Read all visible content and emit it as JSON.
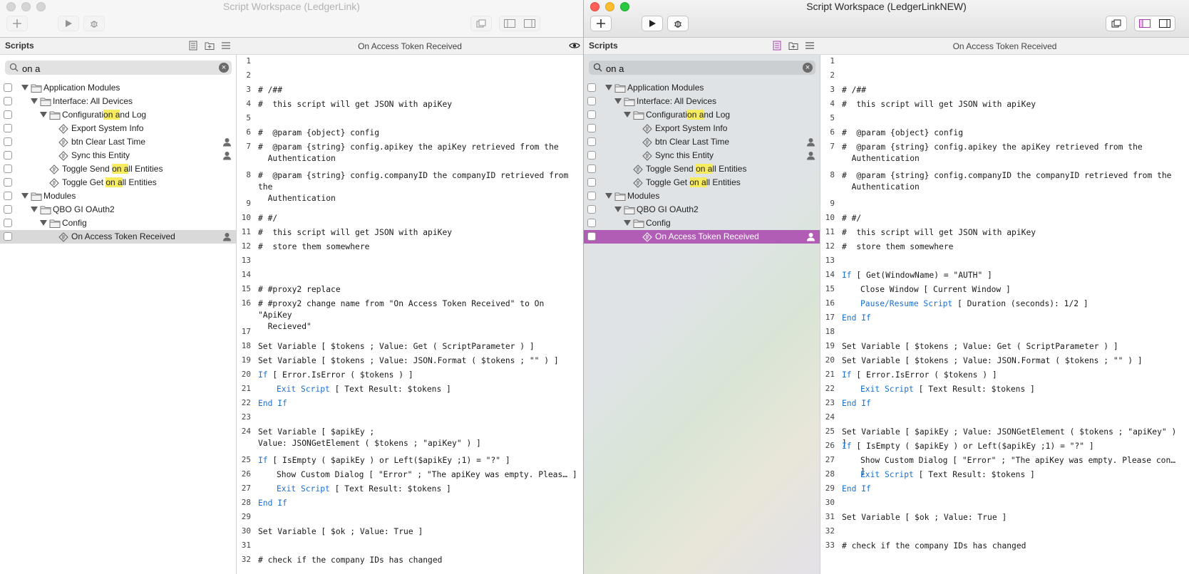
{
  "left_window": {
    "title": "Script Workspace (LedgerLink)",
    "scripts_label": "Scripts",
    "search_value": "on a",
    "editor_title": "On Access Token Received",
    "tree": [
      {
        "label": "Application Modules",
        "level": 0,
        "type": "folder",
        "expanded": true
      },
      {
        "label": "Interface: All Devices",
        "level": 1,
        "type": "folder",
        "expanded": true
      },
      {
        "label_pre": "Configurati",
        "label_hl": "on a",
        "label_post": "nd Log",
        "level": 2,
        "type": "folder",
        "expanded": true
      },
      {
        "label": "Export System Info",
        "level": 3,
        "type": "script"
      },
      {
        "label": "btn Clear Last Time",
        "level": 3,
        "type": "script",
        "user": true
      },
      {
        "label": "Sync this Entity",
        "level": 3,
        "type": "script",
        "user": true
      },
      {
        "label_pre": "Toggle Send ",
        "label_hl": "on a",
        "label_post": "ll Entities",
        "level": 2,
        "type": "script"
      },
      {
        "label_pre": "Toggle Get ",
        "label_hl": "on a",
        "label_post": "ll Entities",
        "level": 2,
        "type": "script"
      },
      {
        "label": "Modules",
        "level": 0,
        "type": "folder",
        "expanded": true
      },
      {
        "label": "QBO GI OAuth2",
        "level": 1,
        "type": "folder",
        "expanded": true
      },
      {
        "label": "Config",
        "level": 2,
        "type": "folder",
        "expanded": true
      },
      {
        "label": "On Access Token Received",
        "level": 3,
        "type": "script",
        "user": true,
        "selected": true
      }
    ],
    "code": [
      {
        "n": "1",
        "t": "",
        "c": "plain"
      },
      {
        "n": "2",
        "t": "",
        "c": "plain"
      },
      {
        "n": "3",
        "t": "# /##",
        "c": "cmt"
      },
      {
        "n": "4",
        "t": "#  this script will get JSON with apiKey",
        "c": "cmt"
      },
      {
        "n": "5",
        "t": "",
        "c": "plain"
      },
      {
        "n": "6",
        "t": "#  @param {object} config",
        "c": "cmt"
      },
      {
        "n": "7",
        "t": "#  @param {string} config.apikey the apiKey retrieved from the\n  Authentication",
        "c": "cmt",
        "h": 2
      },
      {
        "n": "8",
        "t": "#  @param {string} config.companyID the companyID retrieved from the\n  Authentication",
        "c": "cmt",
        "h": 2
      },
      {
        "n": "9",
        "t": "",
        "c": "plain"
      },
      {
        "n": "10",
        "t": "# #/",
        "c": "cmt"
      },
      {
        "n": "11",
        "t": "#  this script will get JSON with apiKey",
        "c": "cmt"
      },
      {
        "n": "12",
        "t": "#  store them somewhere",
        "c": "cmt"
      },
      {
        "n": "13",
        "t": "",
        "c": "plain"
      },
      {
        "n": "14",
        "t": "",
        "c": "plain"
      },
      {
        "n": "15",
        "t": "# #proxy2 replace",
        "c": "cmt"
      },
      {
        "n": "16",
        "t": "# #proxy2 change name from \"On Access Token Received\" to On \"ApiKey\n  Recieved\"",
        "c": "cmt",
        "h": 2
      },
      {
        "n": "17",
        "t": "",
        "c": "plain"
      },
      {
        "n": "18",
        "t": "Set Variable [ $tokens ; Value: Get ( ScriptParameter ) ]",
        "c": "plain"
      },
      {
        "n": "19",
        "t": "Set Variable [ $tokens ; Value: JSON.Format ( $tokens ; \"\" ) ]",
        "c": "plain"
      },
      {
        "n": "20",
        "kw": "If",
        "t": " [ Error.IsError ( $tokens ) ]",
        "c": "plain"
      },
      {
        "n": "21",
        "kw": "Exit Script",
        "t": " [ Text Result: $tokens ]",
        "c": "plain",
        "indent": 1
      },
      {
        "n": "22",
        "kw": "End If",
        "t": "",
        "c": "plain"
      },
      {
        "n": "23",
        "t": "",
        "c": "plain"
      },
      {
        "n": "24",
        "t": "Set Variable [ $apikEy ;\nValue: JSONGetElement ( $tokens ; \"apiKey\" ) ]",
        "c": "plain",
        "h": 2
      },
      {
        "n": "25",
        "kw": "If",
        "t": " [ IsEmpty ( $apikEy ) or Left($apikEy ;1) = \"?\" ]",
        "c": "plain"
      },
      {
        "n": "26",
        "t": "Show Custom Dialog [ \"Error\" ; \"The apiKey was empty. Pleas… ]",
        "c": "plain",
        "indent": 1
      },
      {
        "n": "27",
        "kw": "Exit Script",
        "t": " [ Text Result: $tokens ]",
        "c": "plain",
        "indent": 1
      },
      {
        "n": "28",
        "kw": "End If",
        "t": "",
        "c": "plain"
      },
      {
        "n": "29",
        "t": "",
        "c": "plain"
      },
      {
        "n": "30",
        "t": "Set Variable [ $ok ; Value: True ]",
        "c": "plain"
      },
      {
        "n": "31",
        "t": "",
        "c": "plain"
      },
      {
        "n": "32",
        "t": "# check if the company IDs has changed",
        "c": "cmt"
      }
    ]
  },
  "right_window": {
    "title": "Script Workspace (LedgerLinkNEW)",
    "scripts_label": "Scripts",
    "search_value": "on a",
    "editor_title": "On Access Token Received",
    "tree": [
      {
        "label": "Application Modules",
        "level": 0,
        "type": "folder",
        "expanded": true
      },
      {
        "label": "Interface: All Devices",
        "level": 1,
        "type": "folder",
        "expanded": true
      },
      {
        "label_pre": "Configurati",
        "label_hl": "on a",
        "label_post": "nd Log",
        "level": 2,
        "type": "folder",
        "expanded": true
      },
      {
        "label": "Export System Info",
        "level": 3,
        "type": "script"
      },
      {
        "label": "btn Clear Last Time",
        "level": 3,
        "type": "script",
        "user": true
      },
      {
        "label": "Sync this Entity",
        "level": 3,
        "type": "script",
        "user": true
      },
      {
        "label_pre": "Toggle Send ",
        "label_hl": "on a",
        "label_post": "ll Entities",
        "level": 2,
        "type": "script"
      },
      {
        "label_pre": "Toggle Get ",
        "label_hl": "on a",
        "label_post": "ll Entities",
        "level": 2,
        "type": "script"
      },
      {
        "label": "Modules",
        "level": 0,
        "type": "folder",
        "expanded": true
      },
      {
        "label": "QBO GI OAuth2",
        "level": 1,
        "type": "folder",
        "expanded": true
      },
      {
        "label": "Config",
        "level": 2,
        "type": "folder",
        "expanded": true
      },
      {
        "label": "On Access Token Received",
        "level": 3,
        "type": "script",
        "user": true,
        "selected": true
      }
    ],
    "code": [
      {
        "n": "1",
        "t": "",
        "c": "plain"
      },
      {
        "n": "2",
        "t": "",
        "c": "plain"
      },
      {
        "n": "3",
        "t": "# /##",
        "c": "cmt"
      },
      {
        "n": "4",
        "t": "#  this script will get JSON with apiKey",
        "c": "cmt"
      },
      {
        "n": "5",
        "t": "",
        "c": "plain"
      },
      {
        "n": "6",
        "t": "#  @param {object} config",
        "c": "cmt"
      },
      {
        "n": "7",
        "t": "#  @param {string} config.apikey the apiKey retrieved from the\n  Authentication",
        "c": "cmt",
        "h": 2
      },
      {
        "n": "8",
        "t": "#  @param {string} config.companyID the companyID retrieved from the\n  Authentication",
        "c": "cmt",
        "h": 2
      },
      {
        "n": "9",
        "t": "",
        "c": "plain"
      },
      {
        "n": "10",
        "t": "# #/",
        "c": "cmt"
      },
      {
        "n": "11",
        "t": "#  this script will get JSON with apiKey",
        "c": "cmt"
      },
      {
        "n": "12",
        "t": "#  store them somewhere",
        "c": "cmt"
      },
      {
        "n": "13",
        "t": "",
        "c": "plain"
      },
      {
        "n": "14",
        "kw": "If",
        "t": " [ Get(WindowName) = \"AUTH\" ]",
        "c": "plain"
      },
      {
        "n": "15",
        "t": "Close Window [ Current Window ]",
        "c": "plain",
        "indent": 1
      },
      {
        "n": "16",
        "kw": "Pause/Resume Script",
        "t": " [ Duration (seconds): 1/2 ]",
        "c": "plain",
        "indent": 1
      },
      {
        "n": "17",
        "kw": "End If",
        "t": "",
        "c": "plain"
      },
      {
        "n": "18",
        "t": "",
        "c": "plain"
      },
      {
        "n": "19",
        "t": "Set Variable [ $tokens ; Value: Get ( ScriptParameter ) ]",
        "c": "plain"
      },
      {
        "n": "20",
        "t": "Set Variable [ $tokens ; Value: JSON.Format ( $tokens ; \"\" ) ]",
        "c": "plain"
      },
      {
        "n": "21",
        "kw": "If",
        "t": " [ Error.IsError ( $tokens ) ]",
        "c": "plain"
      },
      {
        "n": "22",
        "kw": "Exit Script",
        "t": " [ Text Result: $tokens ]",
        "c": "plain",
        "indent": 1
      },
      {
        "n": "23",
        "kw": "End If",
        "t": "",
        "c": "plain"
      },
      {
        "n": "24",
        "t": "",
        "c": "plain"
      },
      {
        "n": "25",
        "t": "Set Variable [ $apikEy ; Value: JSONGetElement ( $tokens ; \"apiKey\" ) ]",
        "c": "plain"
      },
      {
        "n": "26",
        "kw": "If",
        "t": " [ IsEmpty ( $apikEy ) or Left($apikEy ;1) = \"?\" ]",
        "c": "plain"
      },
      {
        "n": "27",
        "t": "Show Custom Dialog [ \"Error\" ; \"The apiKey was empty. Please con… ]",
        "c": "plain",
        "indent": 1
      },
      {
        "n": "28",
        "kw": "Exit Script",
        "t": " [ Text Result: $tokens ]",
        "c": "plain",
        "indent": 1
      },
      {
        "n": "29",
        "kw": "End If",
        "t": "",
        "c": "plain"
      },
      {
        "n": "30",
        "t": "",
        "c": "plain"
      },
      {
        "n": "31",
        "t": "Set Variable [ $ok ; Value: True ]",
        "c": "plain"
      },
      {
        "n": "32",
        "t": "",
        "c": "plain"
      },
      {
        "n": "33",
        "t": "# check if the company IDs has changed",
        "c": "cmt"
      }
    ]
  },
  "colors": {
    "comment": "#1e7a1e",
    "keyword": "#1a6fd3",
    "selection_active": "#b25db5",
    "selection_inactive": "#d9d9d9",
    "search_highlight": "#f7eb60"
  },
  "icons": [
    "plus-icon",
    "play-icon",
    "debug-bug-icon",
    "copy-windows-icon",
    "sidebar-left-icon",
    "sidebar-right-icon",
    "script-list-icon",
    "new-folder-icon",
    "menu-lines-icon",
    "search-icon",
    "clear-search-icon",
    "folder-icon",
    "script-icon",
    "user-icon",
    "eye-icon"
  ]
}
